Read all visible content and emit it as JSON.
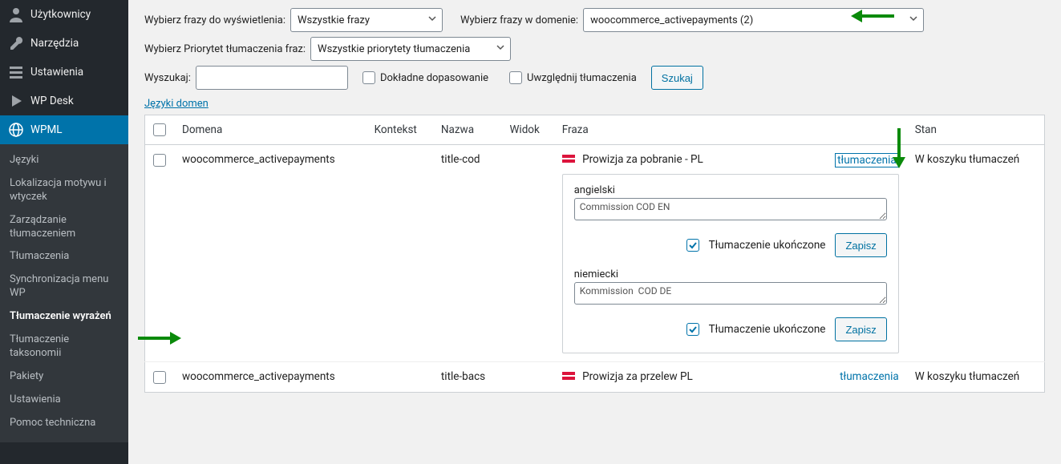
{
  "sidebar": {
    "items": [
      {
        "label": "Użytkownicy"
      },
      {
        "label": "Narzędzia"
      },
      {
        "label": "Ustawienia"
      },
      {
        "label": "WP Desk"
      },
      {
        "label": "WPML"
      }
    ],
    "submenu": [
      {
        "label": "Języki"
      },
      {
        "label": "Lokalizacja motywu i wtyczek"
      },
      {
        "label": "Zarządzanie tłumaczeniem"
      },
      {
        "label": "Tłumaczenia"
      },
      {
        "label": "Synchronizacja menu WP"
      },
      {
        "label": "Tłumaczenie wyrażeń"
      },
      {
        "label": "Tłumaczenie taksonomii"
      },
      {
        "label": "Pakiety"
      },
      {
        "label": "Ustawienia"
      },
      {
        "label": "Pomoc techniczna"
      }
    ]
  },
  "filters": {
    "select_display_label": "Wybierz frazy do wyświetlenia:",
    "select_display_value": "Wszystkie frazy",
    "select_domain_label": "Wybierz frazy w domenie:",
    "select_domain_value": "woocommerce_activepayments (2)",
    "select_priority_label": "Wybierz Priorytet tłumaczenia fraz:",
    "select_priority_value": "Wszystkie priorytety tłumaczenia",
    "search_label": "Wyszukaj:",
    "exact_label": "Dokładne dopasowanie",
    "include_label": "Uwzględnij tłumaczenia",
    "search_btn": "Szukaj",
    "lang_domains_link": "Języki domen"
  },
  "table": {
    "headers": {
      "domena": "Domena",
      "kontekst": "Kontekst",
      "nazwa": "Nazwa",
      "widok": "Widok",
      "fraza": "Fraza",
      "stan": "Stan"
    },
    "rows": [
      {
        "domena": "woocommerce_activepayments",
        "nazwa": "title-cod",
        "fraza": "Prowizja za pobranie - PL",
        "stan": "W koszyku tłumaczeń",
        "trans_link": "tłumaczenia",
        "translations": [
          {
            "lang": "angielski",
            "value": "Commission COD EN",
            "complete_label": "Tłumaczenie ukończone",
            "save": "Zapisz"
          },
          {
            "lang": "niemiecki",
            "value": "Kommission  COD DE",
            "complete_label": "Tłumaczenie ukończone",
            "save": "Zapisz"
          }
        ]
      },
      {
        "domena": "woocommerce_activepayments",
        "nazwa": "title-bacs",
        "fraza": "Prowizja za przelew PL",
        "stan": "W koszyku tłumaczeń",
        "trans_link": "tłumaczenia"
      }
    ]
  },
  "arrows": {
    "color": "#0a8a0a",
    "arrow1": "points left at domain select",
    "arrow2": "points down at translations toggle",
    "arrow3": "points right at sidebar submenu Tłumaczenie wyrażeń"
  }
}
